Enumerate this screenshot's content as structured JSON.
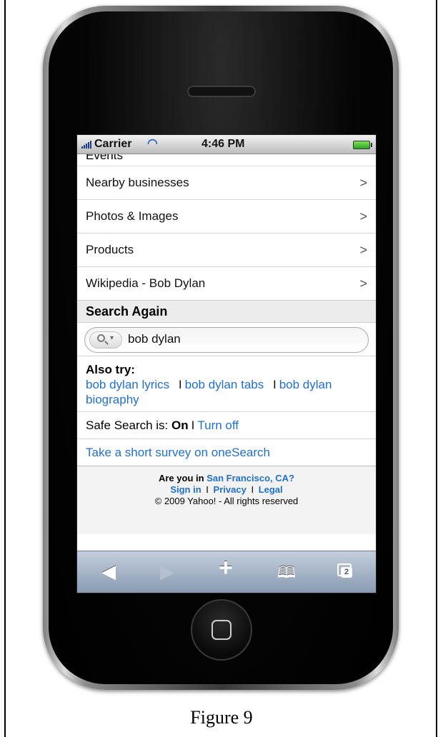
{
  "statusbar": {
    "carrier": "Carrier",
    "time": "4:46 PM"
  },
  "list": {
    "cutoff_label": "Events",
    "items": [
      {
        "label": "Nearby businesses"
      },
      {
        "label": "Photos & Images"
      },
      {
        "label": "Products"
      },
      {
        "label": "Wikipedia - Bob Dylan"
      }
    ]
  },
  "search_again": {
    "heading": "Search Again",
    "query": "bob dylan"
  },
  "also_try": {
    "heading": "Also try:",
    "separator": "I",
    "links": [
      "bob dylan lyrics",
      "bob dylan tabs",
      "bob dylan biography"
    ]
  },
  "safe_search": {
    "label": "Safe Search is:",
    "state": "On",
    "separator": "I",
    "action": "Turn off"
  },
  "survey_link": "Take a short survey on oneSearch",
  "footer": {
    "location_prefix": "Are you in",
    "location": "San Francisco, CA?",
    "sign_in": "Sign in",
    "privacy": "Privacy",
    "legal": "Legal",
    "separator": "I",
    "copyright": "© 2009 Yahoo! - All rights reserved"
  },
  "toolbar": {
    "tab_count": "2"
  },
  "caption": "Figure 9",
  "icons": {
    "back": "back-arrow-icon",
    "forward": "forward-arrow-icon",
    "add": "plus-icon",
    "bookmarks": "bookmarks-icon",
    "tabs": "tabs-icon",
    "wifi": "wifi-icon",
    "battery": "battery-icon",
    "signal": "signal-bars-icon",
    "search": "search-icon"
  },
  "colors": {
    "link": "#1f6fd0",
    "toolbar": "#8a9ab2",
    "battery": "#2fa41f"
  }
}
